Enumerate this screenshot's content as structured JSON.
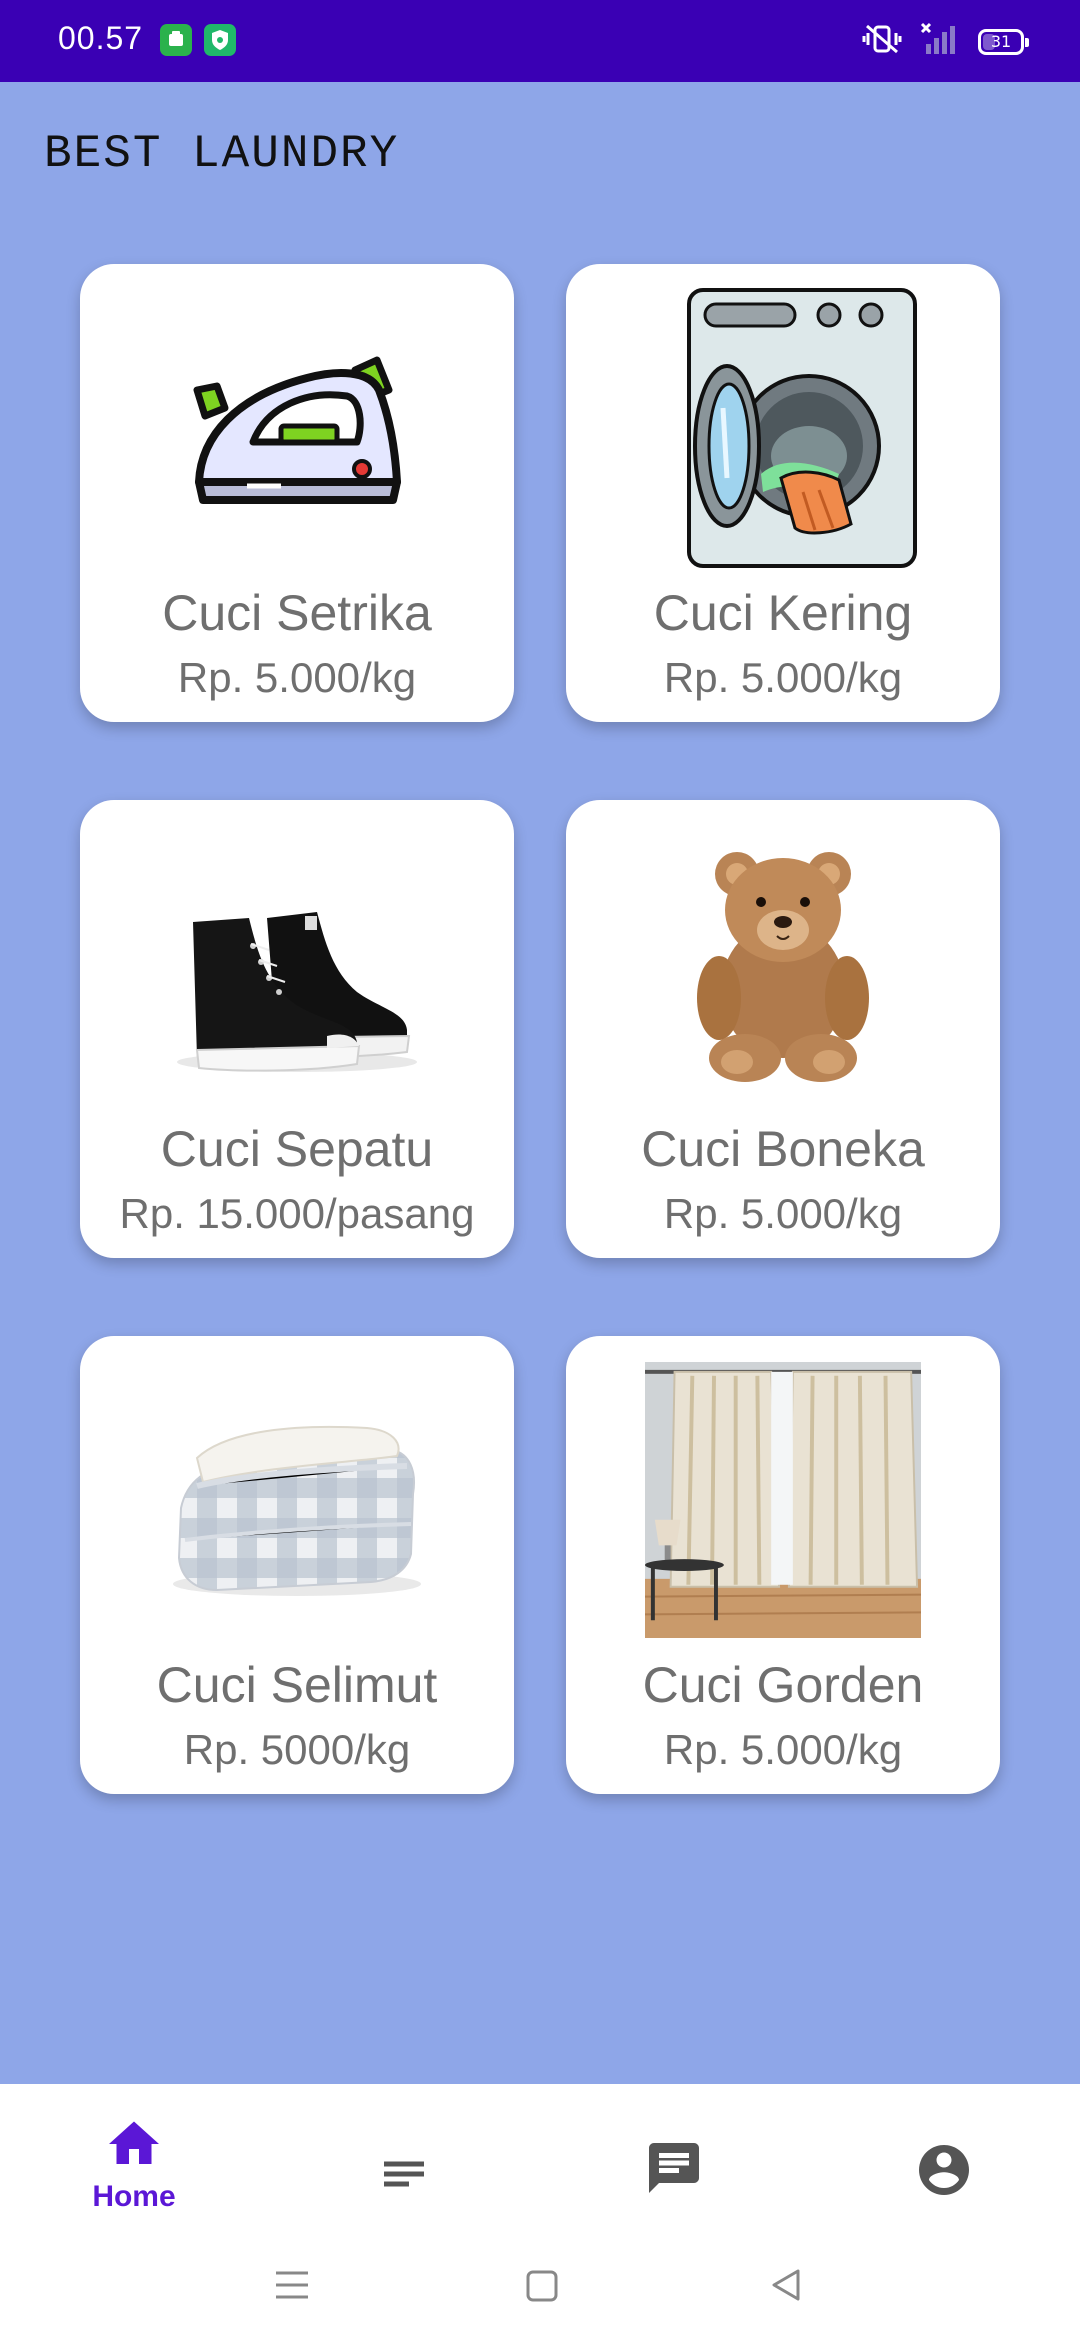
{
  "status_bar": {
    "time": "00.57",
    "battery": "31"
  },
  "app": {
    "title": "BEST LAUNDRY"
  },
  "services": [
    {
      "name": "Cuci Setrika",
      "price": "Rp. 5.000/kg",
      "icon": "iron-icon"
    },
    {
      "name": "Cuci Kering",
      "price": "Rp. 5.000/kg",
      "icon": "washing-machine-icon"
    },
    {
      "name": "Cuci Sepatu",
      "price": "Rp. 15.000/pasang",
      "icon": "sneakers-image"
    },
    {
      "name": "Cuci Boneka",
      "price": "Rp. 5.000/kg",
      "icon": "teddy-bear-image"
    },
    {
      "name": "Cuci Selimut",
      "price": "Rp. 5000/kg",
      "icon": "blanket-image"
    },
    {
      "name": "Cuci Gorden",
      "price": "Rp. 5.000/kg",
      "icon": "curtain-image"
    }
  ],
  "bottom_nav": {
    "items": [
      {
        "label": "Home",
        "icon": "home-icon",
        "active": true
      },
      {
        "label": "",
        "icon": "list-icon",
        "active": false
      },
      {
        "label": "",
        "icon": "chat-icon",
        "active": false
      },
      {
        "label": "",
        "icon": "account-icon",
        "active": false
      }
    ]
  },
  "colors": {
    "status_bar": "#3a00b4",
    "background": "#8ea6e8",
    "accent": "#5b17d6",
    "card": "#ffffff"
  }
}
